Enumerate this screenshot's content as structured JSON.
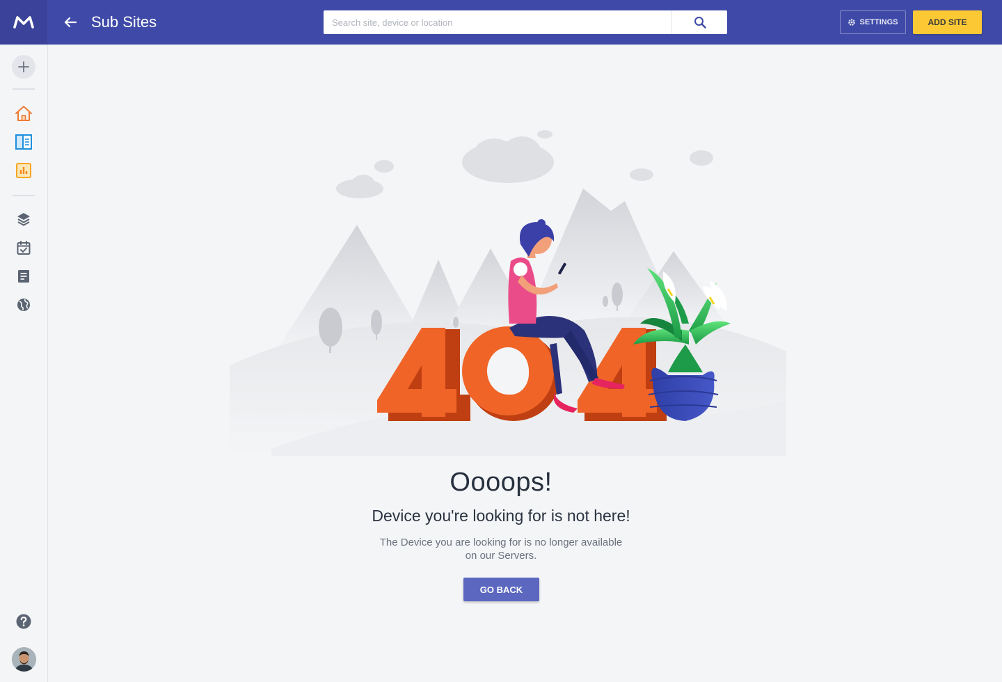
{
  "header": {
    "title": "Sub Sites",
    "search_placeholder": "Search site, device or location",
    "settings_label": "SETTINGS",
    "add_site_label": "ADD SITE"
  },
  "sidebar": {
    "icons": [
      "plus-icon",
      "home-icon",
      "columns-icon",
      "chart-icon",
      "layers-icon",
      "calendar-check-icon",
      "document-icon",
      "globe-icon",
      "help-icon"
    ]
  },
  "error": {
    "headline": "Oooops!",
    "subheadline": "Device you're looking for is not here!",
    "description": "The Device you are looking for is no longer available on our Servers.",
    "button_label": "GO BACK"
  },
  "colors": {
    "primary": "#3f4aa8",
    "accent": "#fcc935",
    "button": "#5c67c0",
    "error_orange": "#f06427"
  }
}
